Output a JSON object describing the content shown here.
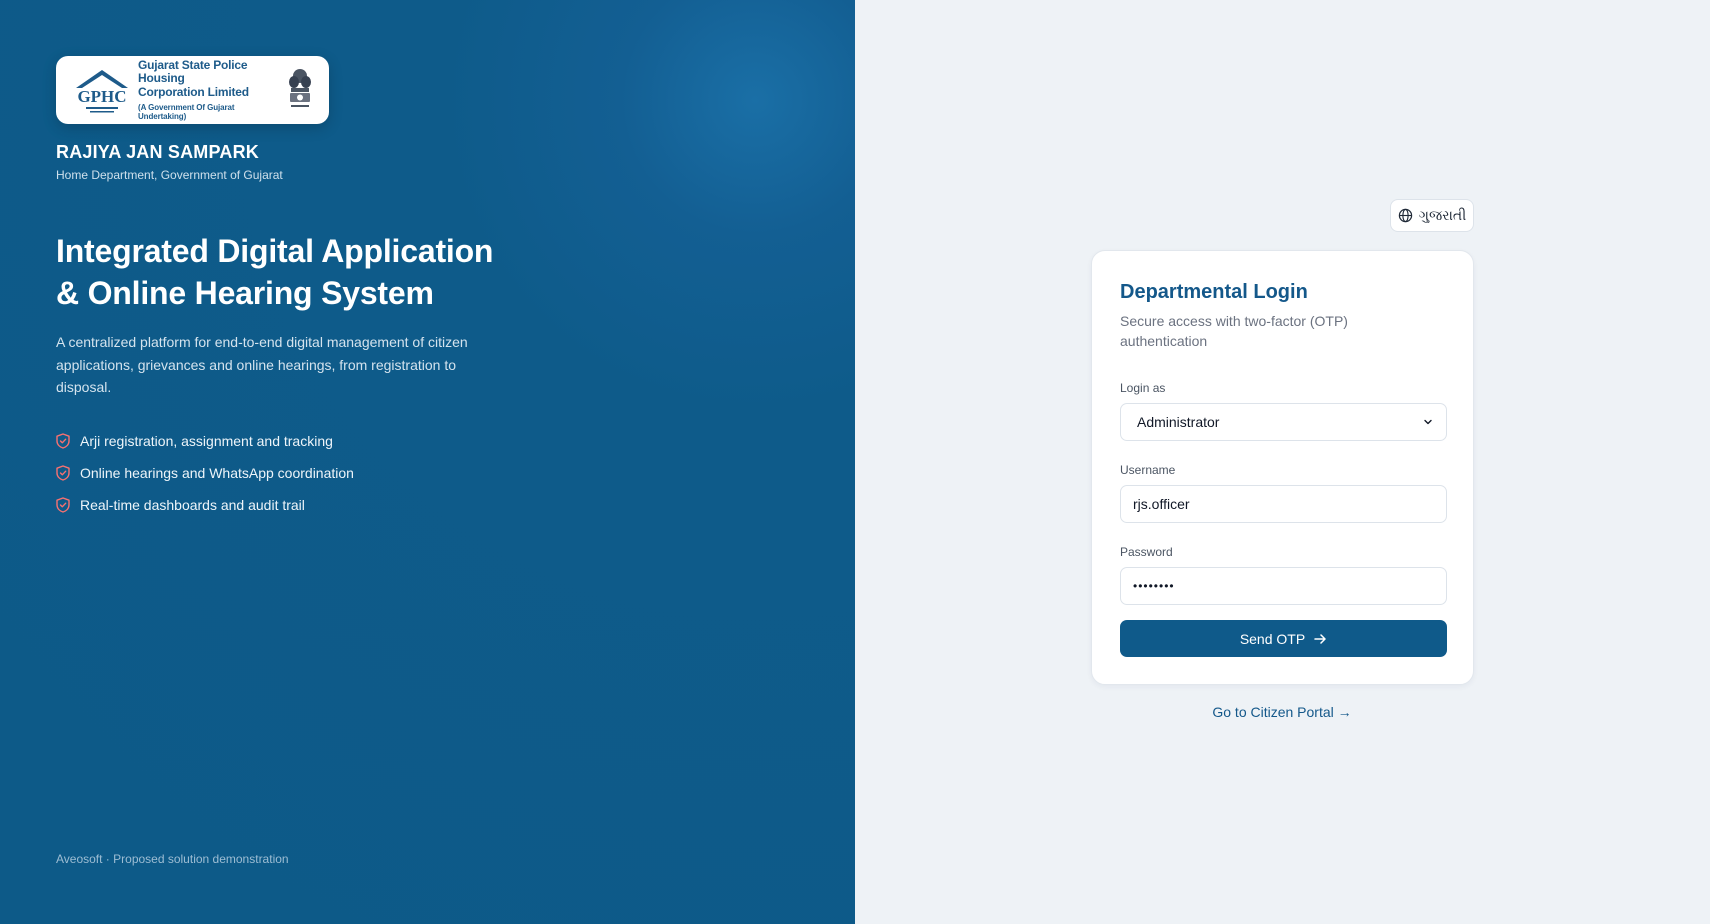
{
  "logo": {
    "org_name_line1": "Gujarat State Police Housing",
    "org_name_line2": "Corporation Limited",
    "org_tagline": "(A Government Of Gujarat Undertaking)",
    "mark_text": "GPHC"
  },
  "brand": {
    "title": "RAJIYA JAN SAMPARK",
    "subtitle": "Home Department, Government of Gujarat"
  },
  "hero": {
    "title_line1": "Integrated Digital Application",
    "title_line2": "& Online Hearing System",
    "description": "A centralized platform for end-to-end digital management of citizen applications, grievances and online hearings, from registration to disposal."
  },
  "features": [
    "Arji registration, assignment and tracking",
    "Online hearings and WhatsApp coordination",
    "Real-time dashboards and audit trail"
  ],
  "footer_note": "Aveosoft · Proposed solution demonstration",
  "language_toggle": {
    "label": "ગુજરાતી",
    "icon": "globe-icon"
  },
  "login": {
    "title": "Departmental Login",
    "subtitle": "Secure access with two-factor (OTP) authentication",
    "role_label": "Login as",
    "role_value": "Administrator",
    "username_label": "Username",
    "username_value": "rjs.officer",
    "password_label": "Password",
    "password_value": "••••••••",
    "submit_label": "Send OTP"
  },
  "citizen_link": "Go to Citizen Portal →",
  "colors": {
    "left_panel_bg": "#0d5a88",
    "accent": "#0f5a8a",
    "heading": "#14588a",
    "feature_icon": "#f87171",
    "right_panel_bg": "#eef2f6"
  }
}
